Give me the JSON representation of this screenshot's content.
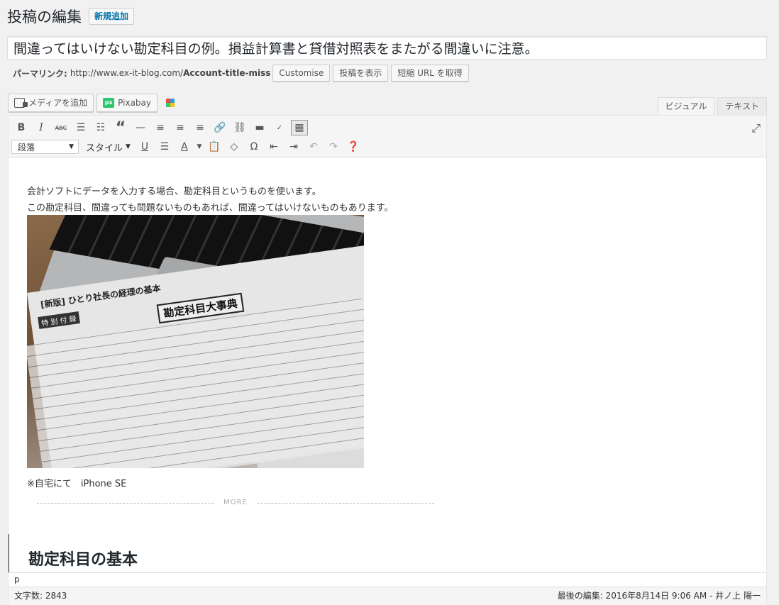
{
  "page": {
    "title": "投稿の編集",
    "add_new_label": "新規追加"
  },
  "post": {
    "title": "間違ってはいけない勘定科目の例。損益計算書と貸借対照表をまたがる間違いに注意。"
  },
  "permalink": {
    "label": "パーマリンク:",
    "base": "http://www.ex-it-blog.com/",
    "slug": "Account-title-miss",
    "buttons": [
      "Customise",
      "投稿を表示",
      "短縮 URL を取得"
    ]
  },
  "media_buttons": {
    "add_media": "メディアを追加",
    "pixabay": "Pixabay"
  },
  "editor_tabs": [
    "ビジュアル",
    "テキスト"
  ],
  "toolbar": {
    "row1": [
      "bold-icon",
      "italic-icon",
      "strikethrough-icon",
      "bullet-list-icon",
      "numbered-list-icon",
      "blockquote-icon",
      "horizontal-line-icon",
      "align-left-icon",
      "align-center-icon",
      "align-right-icon",
      "link-icon",
      "unlink-icon",
      "read-more-icon",
      "spellcheck-icon",
      "toolbar-toggle-icon"
    ],
    "format_select": "段落",
    "style_dropdown": "スタイル",
    "row2": [
      "underline-icon",
      "justify-icon",
      "text-color-icon",
      "paste-text-icon",
      "clear-format-icon",
      "special-char-icon",
      "outdent-icon",
      "indent-icon",
      "undo-icon",
      "redo-icon",
      "help-icon"
    ]
  },
  "content": {
    "para1": "会計ソフトにデータを入力する場合、勘定科目というものを使います。",
    "para2": "この勘定科目、間違っても問題ないものもあれば、間違ってはいけないものもあります。",
    "photo_heading": "[新版] ひとり社長の経理の基本",
    "photo_sub": "特 別 付 録",
    "photo_title": "勘定科目大事典",
    "caption": "※自宅にて　iPhone SE",
    "more_label": "MORE",
    "heading": "勘定科目の基本"
  },
  "status": {
    "path": "p",
    "word_count": "文字数: 2843",
    "last_edited": "最後の編集: 2016年8月14日 9:06 AM - 井ノ上 陽一"
  }
}
